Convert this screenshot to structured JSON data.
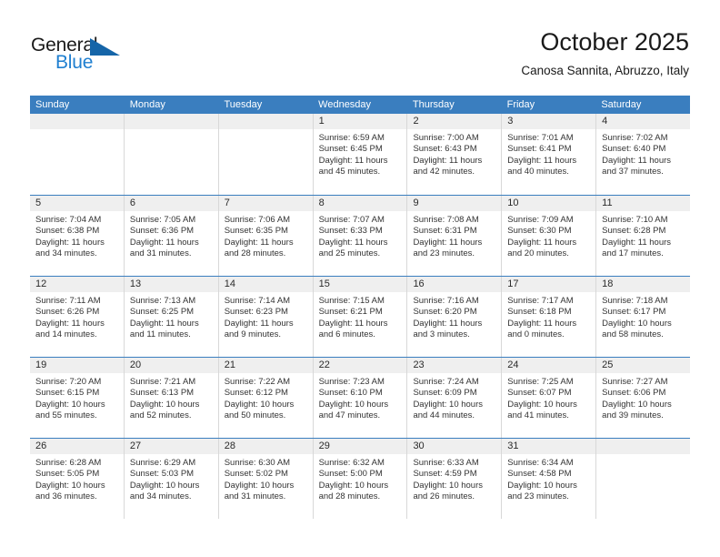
{
  "brand": {
    "word_one": "General",
    "word_two": "Blue",
    "triangle_color": "#1565a8",
    "accent_color": "#1f7fd0"
  },
  "header": {
    "title": "October 2025",
    "subtitle": "Canosa Sannita, Abruzzo, Italy"
  },
  "calendar": {
    "header_bg": "#3a7ebf",
    "daynumber_bg": "#efefef",
    "weekdays": [
      "Sunday",
      "Monday",
      "Tuesday",
      "Wednesday",
      "Thursday",
      "Friday",
      "Saturday"
    ],
    "weeks": [
      [
        {
          "day": "",
          "sunrise": "",
          "sunset": "",
          "daylight": "",
          "empty": true
        },
        {
          "day": "",
          "sunrise": "",
          "sunset": "",
          "daylight": "",
          "empty": true
        },
        {
          "day": "",
          "sunrise": "",
          "sunset": "",
          "daylight": "",
          "empty": true
        },
        {
          "day": "1",
          "sunrise": "Sunrise: 6:59 AM",
          "sunset": "Sunset: 6:45 PM",
          "daylight": "Daylight: 11 hours and 45 minutes."
        },
        {
          "day": "2",
          "sunrise": "Sunrise: 7:00 AM",
          "sunset": "Sunset: 6:43 PM",
          "daylight": "Daylight: 11 hours and 42 minutes."
        },
        {
          "day": "3",
          "sunrise": "Sunrise: 7:01 AM",
          "sunset": "Sunset: 6:41 PM",
          "daylight": "Daylight: 11 hours and 40 minutes."
        },
        {
          "day": "4",
          "sunrise": "Sunrise: 7:02 AM",
          "sunset": "Sunset: 6:40 PM",
          "daylight": "Daylight: 11 hours and 37 minutes."
        }
      ],
      [
        {
          "day": "5",
          "sunrise": "Sunrise: 7:04 AM",
          "sunset": "Sunset: 6:38 PM",
          "daylight": "Daylight: 11 hours and 34 minutes."
        },
        {
          "day": "6",
          "sunrise": "Sunrise: 7:05 AM",
          "sunset": "Sunset: 6:36 PM",
          "daylight": "Daylight: 11 hours and 31 minutes."
        },
        {
          "day": "7",
          "sunrise": "Sunrise: 7:06 AM",
          "sunset": "Sunset: 6:35 PM",
          "daylight": "Daylight: 11 hours and 28 minutes."
        },
        {
          "day": "8",
          "sunrise": "Sunrise: 7:07 AM",
          "sunset": "Sunset: 6:33 PM",
          "daylight": "Daylight: 11 hours and 25 minutes."
        },
        {
          "day": "9",
          "sunrise": "Sunrise: 7:08 AM",
          "sunset": "Sunset: 6:31 PM",
          "daylight": "Daylight: 11 hours and 23 minutes."
        },
        {
          "day": "10",
          "sunrise": "Sunrise: 7:09 AM",
          "sunset": "Sunset: 6:30 PM",
          "daylight": "Daylight: 11 hours and 20 minutes."
        },
        {
          "day": "11",
          "sunrise": "Sunrise: 7:10 AM",
          "sunset": "Sunset: 6:28 PM",
          "daylight": "Daylight: 11 hours and 17 minutes."
        }
      ],
      [
        {
          "day": "12",
          "sunrise": "Sunrise: 7:11 AM",
          "sunset": "Sunset: 6:26 PM",
          "daylight": "Daylight: 11 hours and 14 minutes."
        },
        {
          "day": "13",
          "sunrise": "Sunrise: 7:13 AM",
          "sunset": "Sunset: 6:25 PM",
          "daylight": "Daylight: 11 hours and 11 minutes."
        },
        {
          "day": "14",
          "sunrise": "Sunrise: 7:14 AM",
          "sunset": "Sunset: 6:23 PM",
          "daylight": "Daylight: 11 hours and 9 minutes."
        },
        {
          "day": "15",
          "sunrise": "Sunrise: 7:15 AM",
          "sunset": "Sunset: 6:21 PM",
          "daylight": "Daylight: 11 hours and 6 minutes."
        },
        {
          "day": "16",
          "sunrise": "Sunrise: 7:16 AM",
          "sunset": "Sunset: 6:20 PM",
          "daylight": "Daylight: 11 hours and 3 minutes."
        },
        {
          "day": "17",
          "sunrise": "Sunrise: 7:17 AM",
          "sunset": "Sunset: 6:18 PM",
          "daylight": "Daylight: 11 hours and 0 minutes."
        },
        {
          "day": "18",
          "sunrise": "Sunrise: 7:18 AM",
          "sunset": "Sunset: 6:17 PM",
          "daylight": "Daylight: 10 hours and 58 minutes."
        }
      ],
      [
        {
          "day": "19",
          "sunrise": "Sunrise: 7:20 AM",
          "sunset": "Sunset: 6:15 PM",
          "daylight": "Daylight: 10 hours and 55 minutes."
        },
        {
          "day": "20",
          "sunrise": "Sunrise: 7:21 AM",
          "sunset": "Sunset: 6:13 PM",
          "daylight": "Daylight: 10 hours and 52 minutes."
        },
        {
          "day": "21",
          "sunrise": "Sunrise: 7:22 AM",
          "sunset": "Sunset: 6:12 PM",
          "daylight": "Daylight: 10 hours and 50 minutes."
        },
        {
          "day": "22",
          "sunrise": "Sunrise: 7:23 AM",
          "sunset": "Sunset: 6:10 PM",
          "daylight": "Daylight: 10 hours and 47 minutes."
        },
        {
          "day": "23",
          "sunrise": "Sunrise: 7:24 AM",
          "sunset": "Sunset: 6:09 PM",
          "daylight": "Daylight: 10 hours and 44 minutes."
        },
        {
          "day": "24",
          "sunrise": "Sunrise: 7:25 AM",
          "sunset": "Sunset: 6:07 PM",
          "daylight": "Daylight: 10 hours and 41 minutes."
        },
        {
          "day": "25",
          "sunrise": "Sunrise: 7:27 AM",
          "sunset": "Sunset: 6:06 PM",
          "daylight": "Daylight: 10 hours and 39 minutes."
        }
      ],
      [
        {
          "day": "26",
          "sunrise": "Sunrise: 6:28 AM",
          "sunset": "Sunset: 5:05 PM",
          "daylight": "Daylight: 10 hours and 36 minutes."
        },
        {
          "day": "27",
          "sunrise": "Sunrise: 6:29 AM",
          "sunset": "Sunset: 5:03 PM",
          "daylight": "Daylight: 10 hours and 34 minutes."
        },
        {
          "day": "28",
          "sunrise": "Sunrise: 6:30 AM",
          "sunset": "Sunset: 5:02 PM",
          "daylight": "Daylight: 10 hours and 31 minutes."
        },
        {
          "day": "29",
          "sunrise": "Sunrise: 6:32 AM",
          "sunset": "Sunset: 5:00 PM",
          "daylight": "Daylight: 10 hours and 28 minutes."
        },
        {
          "day": "30",
          "sunrise": "Sunrise: 6:33 AM",
          "sunset": "Sunset: 4:59 PM",
          "daylight": "Daylight: 10 hours and 26 minutes."
        },
        {
          "day": "31",
          "sunrise": "Sunrise: 6:34 AM",
          "sunset": "Sunset: 4:58 PM",
          "daylight": "Daylight: 10 hours and 23 minutes."
        },
        {
          "day": "",
          "sunrise": "",
          "sunset": "",
          "daylight": "",
          "empty": true
        }
      ]
    ]
  }
}
